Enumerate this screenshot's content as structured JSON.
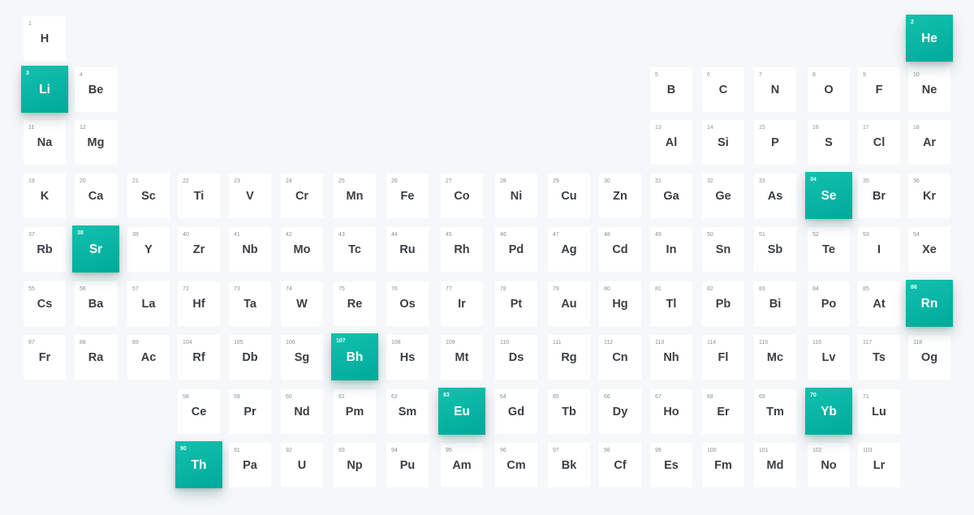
{
  "table": {
    "highlight_color": "#0fb9a8",
    "elements": [
      {
        "n": "1",
        "s": "H",
        "r": 0,
        "c": 0
      },
      {
        "n": "2",
        "s": "He",
        "r": 0,
        "c": 17,
        "active": true
      },
      {
        "n": "3",
        "s": "Li",
        "r": 1,
        "c": 0,
        "active": true
      },
      {
        "n": "4",
        "s": "Be",
        "r": 1,
        "c": 1
      },
      {
        "n": "5",
        "s": "B",
        "r": 1,
        "c": 12
      },
      {
        "n": "6",
        "s": "C",
        "r": 1,
        "c": 13
      },
      {
        "n": "7",
        "s": "N",
        "r": 1,
        "c": 14
      },
      {
        "n": "8",
        "s": "O",
        "r": 1,
        "c": 15
      },
      {
        "n": "9",
        "s": "F",
        "r": 1,
        "c": 16
      },
      {
        "n": "10",
        "s": "Ne",
        "r": 1,
        "c": 17
      },
      {
        "n": "11",
        "s": "Na",
        "r": 2,
        "c": 0
      },
      {
        "n": "12",
        "s": "Mg",
        "r": 2,
        "c": 1
      },
      {
        "n": "13",
        "s": "Al",
        "r": 2,
        "c": 12
      },
      {
        "n": "14",
        "s": "Si",
        "r": 2,
        "c": 13
      },
      {
        "n": "15",
        "s": "P",
        "r": 2,
        "c": 14
      },
      {
        "n": "16",
        "s": "S",
        "r": 2,
        "c": 15
      },
      {
        "n": "17",
        "s": "Cl",
        "r": 2,
        "c": 16
      },
      {
        "n": "18",
        "s": "Ar",
        "r": 2,
        "c": 17
      },
      {
        "n": "19",
        "s": "K",
        "r": 3,
        "c": 0
      },
      {
        "n": "20",
        "s": "Ca",
        "r": 3,
        "c": 1
      },
      {
        "n": "21",
        "s": "Sc",
        "r": 3,
        "c": 2
      },
      {
        "n": "22",
        "s": "Ti",
        "r": 3,
        "c": 3
      },
      {
        "n": "23",
        "s": "V",
        "r": 3,
        "c": 4
      },
      {
        "n": "24",
        "s": "Cr",
        "r": 3,
        "c": 5
      },
      {
        "n": "25",
        "s": "Mn",
        "r": 3,
        "c": 6
      },
      {
        "n": "26",
        "s": "Fe",
        "r": 3,
        "c": 7
      },
      {
        "n": "27",
        "s": "Co",
        "r": 3,
        "c": 8
      },
      {
        "n": "28",
        "s": "Ni",
        "r": 3,
        "c": 9
      },
      {
        "n": "29",
        "s": "Cu",
        "r": 3,
        "c": 10
      },
      {
        "n": "30",
        "s": "Zn",
        "r": 3,
        "c": 11
      },
      {
        "n": "31",
        "s": "Ga",
        "r": 3,
        "c": 12
      },
      {
        "n": "32",
        "s": "Ge",
        "r": 3,
        "c": 13
      },
      {
        "n": "33",
        "s": "As",
        "r": 3,
        "c": 14
      },
      {
        "n": "34",
        "s": "Se",
        "r": 3,
        "c": 15,
        "active": true
      },
      {
        "n": "35",
        "s": "Br",
        "r": 3,
        "c": 16
      },
      {
        "n": "36",
        "s": "Kr",
        "r": 3,
        "c": 17
      },
      {
        "n": "37",
        "s": "Rb",
        "r": 4,
        "c": 0
      },
      {
        "n": "38",
        "s": "Sr",
        "r": 4,
        "c": 1,
        "active": true
      },
      {
        "n": "39",
        "s": "Y",
        "r": 4,
        "c": 2
      },
      {
        "n": "40",
        "s": "Zr",
        "r": 4,
        "c": 3
      },
      {
        "n": "41",
        "s": "Nb",
        "r": 4,
        "c": 4
      },
      {
        "n": "42",
        "s": "Mo",
        "r": 4,
        "c": 5
      },
      {
        "n": "43",
        "s": "Tc",
        "r": 4,
        "c": 6
      },
      {
        "n": "44",
        "s": "Ru",
        "r": 4,
        "c": 7
      },
      {
        "n": "45",
        "s": "Rh",
        "r": 4,
        "c": 8
      },
      {
        "n": "46",
        "s": "Pd",
        "r": 4,
        "c": 9
      },
      {
        "n": "47",
        "s": "Ag",
        "r": 4,
        "c": 10
      },
      {
        "n": "48",
        "s": "Cd",
        "r": 4,
        "c": 11
      },
      {
        "n": "49",
        "s": "In",
        "r": 4,
        "c": 12
      },
      {
        "n": "50",
        "s": "Sn",
        "r": 4,
        "c": 13
      },
      {
        "n": "51",
        "s": "Sb",
        "r": 4,
        "c": 14
      },
      {
        "n": "52",
        "s": "Te",
        "r": 4,
        "c": 15
      },
      {
        "n": "53",
        "s": "I",
        "r": 4,
        "c": 16
      },
      {
        "n": "54",
        "s": "Xe",
        "r": 4,
        "c": 17
      },
      {
        "n": "55",
        "s": "Cs",
        "r": 5,
        "c": 0
      },
      {
        "n": "56",
        "s": "Ba",
        "r": 5,
        "c": 1
      },
      {
        "n": "57",
        "s": "La",
        "r": 5,
        "c": 2
      },
      {
        "n": "72",
        "s": "Hf",
        "r": 5,
        "c": 3
      },
      {
        "n": "73",
        "s": "Ta",
        "r": 5,
        "c": 4
      },
      {
        "n": "74",
        "s": "W",
        "r": 5,
        "c": 5
      },
      {
        "n": "75",
        "s": "Re",
        "r": 5,
        "c": 6
      },
      {
        "n": "76",
        "s": "Os",
        "r": 5,
        "c": 7
      },
      {
        "n": "77",
        "s": "Ir",
        "r": 5,
        "c": 8
      },
      {
        "n": "78",
        "s": "Pt",
        "r": 5,
        "c": 9
      },
      {
        "n": "79",
        "s": "Au",
        "r": 5,
        "c": 10
      },
      {
        "n": "80",
        "s": "Hg",
        "r": 5,
        "c": 11
      },
      {
        "n": "81",
        "s": "Tl",
        "r": 5,
        "c": 12
      },
      {
        "n": "82",
        "s": "Pb",
        "r": 5,
        "c": 13
      },
      {
        "n": "83",
        "s": "Bi",
        "r": 5,
        "c": 14
      },
      {
        "n": "84",
        "s": "Po",
        "r": 5,
        "c": 15
      },
      {
        "n": "85",
        "s": "At",
        "r": 5,
        "c": 16
      },
      {
        "n": "86",
        "s": "Rn",
        "r": 5,
        "c": 17,
        "active": true
      },
      {
        "n": "87",
        "s": "Fr",
        "r": 6,
        "c": 0
      },
      {
        "n": "88",
        "s": "Ra",
        "r": 6,
        "c": 1
      },
      {
        "n": "89",
        "s": "Ac",
        "r": 6,
        "c": 2
      },
      {
        "n": "104",
        "s": "Rf",
        "r": 6,
        "c": 3
      },
      {
        "n": "105",
        "s": "Db",
        "r": 6,
        "c": 4
      },
      {
        "n": "106",
        "s": "Sg",
        "r": 6,
        "c": 5
      },
      {
        "n": "107",
        "s": "Bh",
        "r": 6,
        "c": 6,
        "active": true
      },
      {
        "n": "108",
        "s": "Hs",
        "r": 6,
        "c": 7
      },
      {
        "n": "109",
        "s": "Mt",
        "r": 6,
        "c": 8
      },
      {
        "n": "110",
        "s": "Ds",
        "r": 6,
        "c": 9
      },
      {
        "n": "111",
        "s": "Rg",
        "r": 6,
        "c": 10
      },
      {
        "n": "112",
        "s": "Cn",
        "r": 6,
        "c": 11
      },
      {
        "n": "113",
        "s": "Nh",
        "r": 6,
        "c": 12
      },
      {
        "n": "114",
        "s": "Fl",
        "r": 6,
        "c": 13
      },
      {
        "n": "115",
        "s": "Mc",
        "r": 6,
        "c": 14
      },
      {
        "n": "116",
        "s": "Lv",
        "r": 6,
        "c": 15
      },
      {
        "n": "117",
        "s": "Ts",
        "r": 6,
        "c": 16
      },
      {
        "n": "118",
        "s": "Og",
        "r": 6,
        "c": 17
      },
      {
        "n": "58",
        "s": "Ce",
        "r": 7,
        "c": 3
      },
      {
        "n": "59",
        "s": "Pr",
        "r": 7,
        "c": 4
      },
      {
        "n": "60",
        "s": "Nd",
        "r": 7,
        "c": 5
      },
      {
        "n": "61",
        "s": "Pm",
        "r": 7,
        "c": 6
      },
      {
        "n": "62",
        "s": "Sm",
        "r": 7,
        "c": 7
      },
      {
        "n": "63",
        "s": "Eu",
        "r": 7,
        "c": 8,
        "active": true
      },
      {
        "n": "64",
        "s": "Gd",
        "r": 7,
        "c": 9
      },
      {
        "n": "65",
        "s": "Tb",
        "r": 7,
        "c": 10
      },
      {
        "n": "66",
        "s": "Dy",
        "r": 7,
        "c": 11
      },
      {
        "n": "67",
        "s": "Ho",
        "r": 7,
        "c": 12
      },
      {
        "n": "68",
        "s": "Er",
        "r": 7,
        "c": 13
      },
      {
        "n": "69",
        "s": "Tm",
        "r": 7,
        "c": 14
      },
      {
        "n": "70",
        "s": "Yb",
        "r": 7,
        "c": 15,
        "active": true
      },
      {
        "n": "71",
        "s": "Lu",
        "r": 7,
        "c": 16
      },
      {
        "n": "90",
        "s": "Th",
        "r": 8,
        "c": 3,
        "active": true
      },
      {
        "n": "91",
        "s": "Pa",
        "r": 8,
        "c": 4
      },
      {
        "n": "92",
        "s": "U",
        "r": 8,
        "c": 5
      },
      {
        "n": "93",
        "s": "Np",
        "r": 8,
        "c": 6
      },
      {
        "n": "94",
        "s": "Pu",
        "r": 8,
        "c": 7
      },
      {
        "n": "95",
        "s": "Am",
        "r": 8,
        "c": 8
      },
      {
        "n": "96",
        "s": "Cm",
        "r": 8,
        "c": 9
      },
      {
        "n": "97",
        "s": "Bk",
        "r": 8,
        "c": 10
      },
      {
        "n": "98",
        "s": "Cf",
        "r": 8,
        "c": 11
      },
      {
        "n": "99",
        "s": "Es",
        "r": 8,
        "c": 12
      },
      {
        "n": "100",
        "s": "Fm",
        "r": 8,
        "c": 13
      },
      {
        "n": "101",
        "s": "Md",
        "r": 8,
        "c": 14
      },
      {
        "n": "102",
        "s": "No",
        "r": 8,
        "c": 15
      },
      {
        "n": "103",
        "s": "Lr",
        "r": 8,
        "c": 16
      }
    ]
  }
}
